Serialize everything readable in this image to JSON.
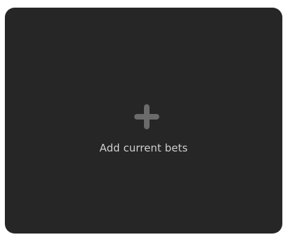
{
  "card": {
    "label": "Add current bets",
    "icon": "plus-icon"
  },
  "colors": {
    "card_background": "#262626",
    "icon": "#6b6b6b",
    "label": "#cfcfcf"
  }
}
